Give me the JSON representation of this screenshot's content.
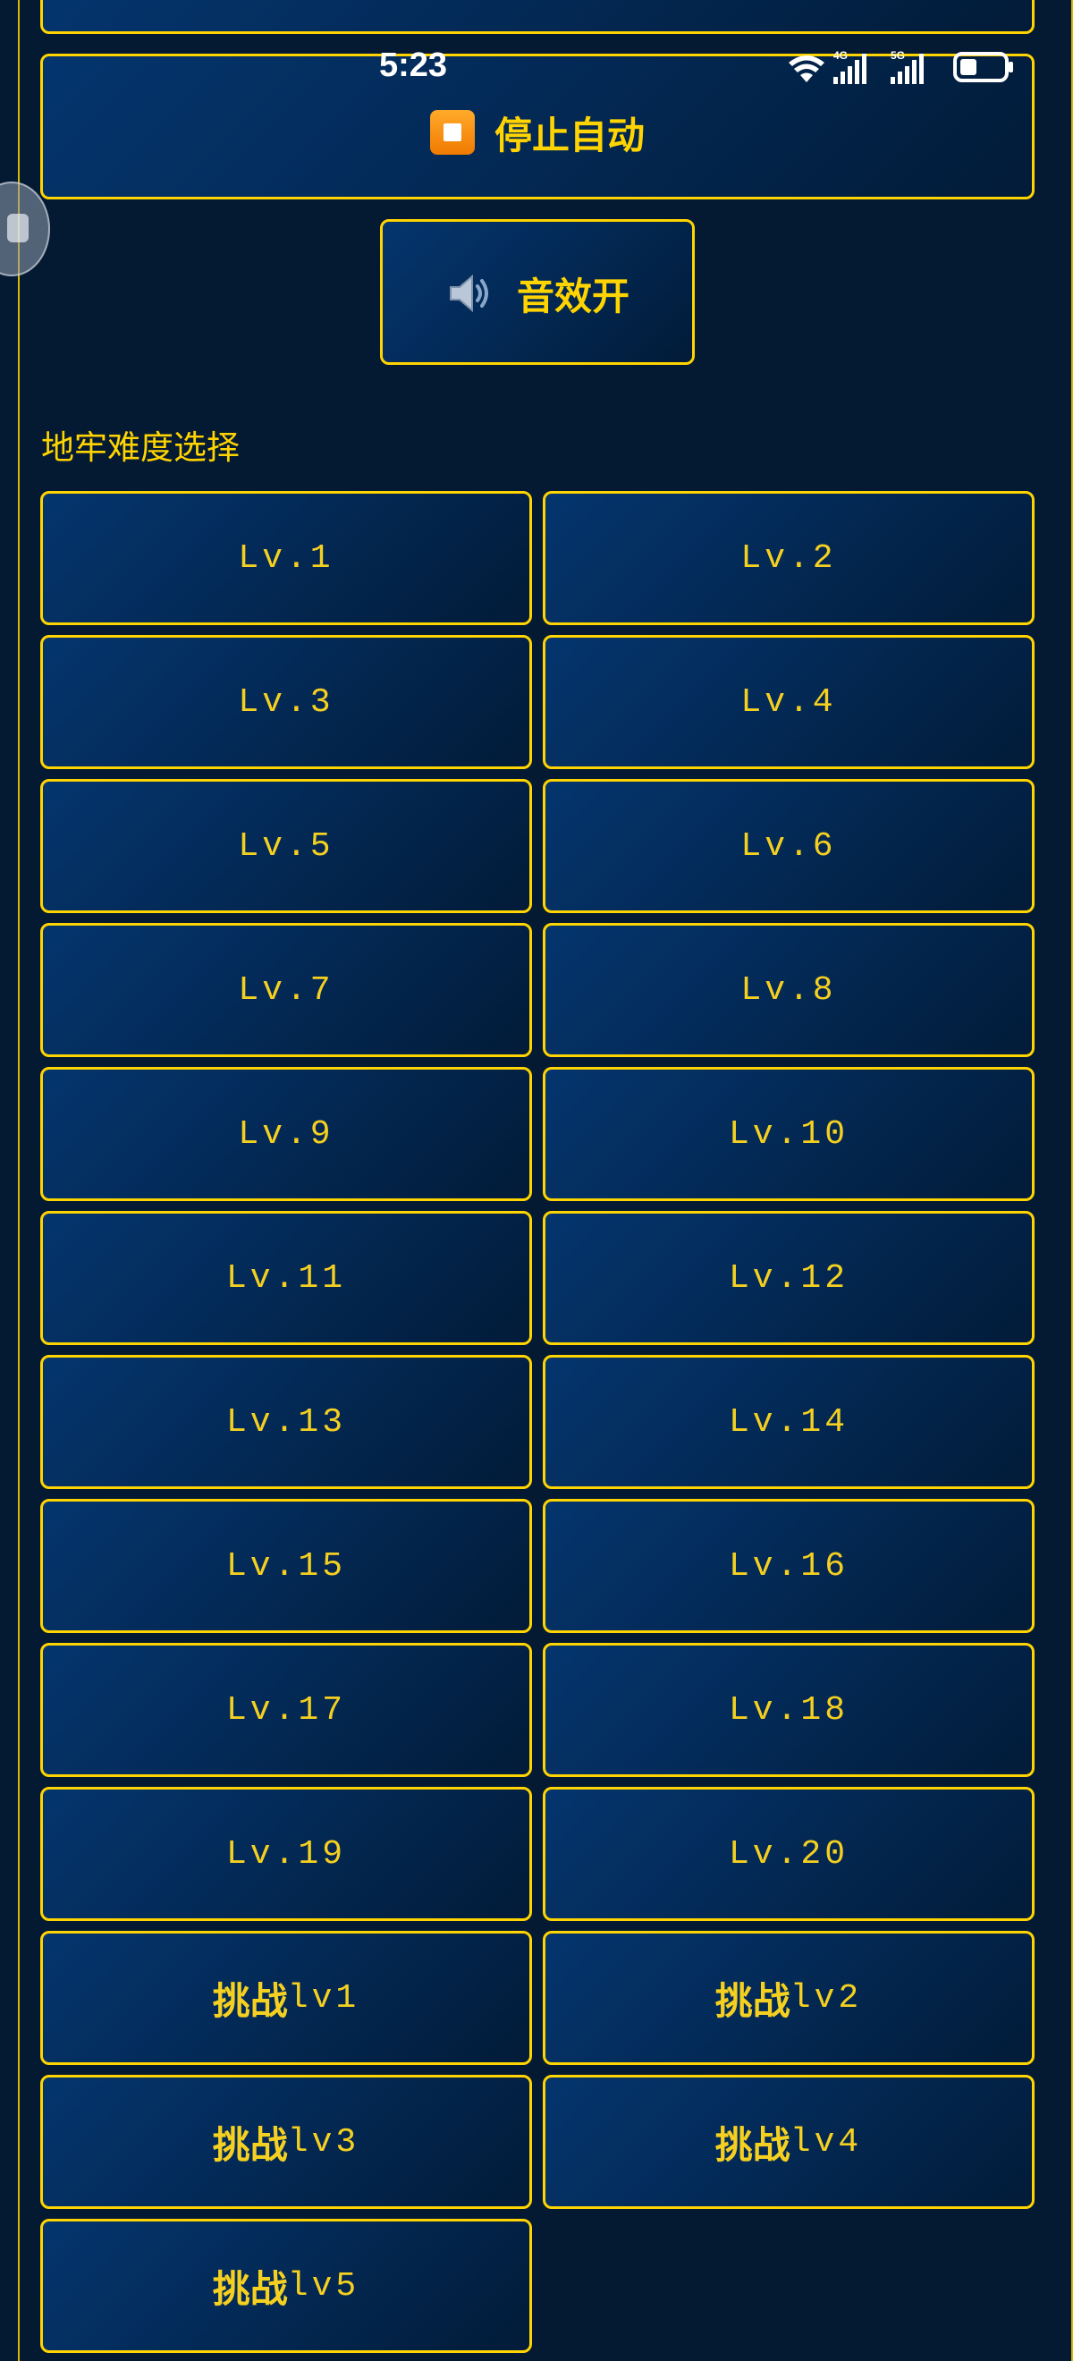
{
  "status_bar": {
    "time": "5:23",
    "network_labels": [
      "4G",
      "5G"
    ]
  },
  "controls": {
    "stop_auto_label": "停止自动",
    "sound_label": "音效开"
  },
  "section": {
    "title": "地牢难度选择"
  },
  "levels": [
    "Lv.1",
    "Lv.2",
    "Lv.3",
    "Lv.4",
    "Lv.5",
    "Lv.6",
    "Lv.7",
    "Lv.8",
    "Lv.9",
    "Lv.10",
    "Lv.11",
    "Lv.12",
    "Lv.13",
    "Lv.14",
    "Lv.15",
    "Lv.16",
    "Lv.17",
    "Lv.18",
    "Lv.19",
    "Lv.20"
  ],
  "challenges": [
    {
      "prefix": "挑战",
      "suffix": "lv1"
    },
    {
      "prefix": "挑战",
      "suffix": "lv2"
    },
    {
      "prefix": "挑战",
      "suffix": "lv3"
    },
    {
      "prefix": "挑战",
      "suffix": "lv4"
    },
    {
      "prefix": "挑战",
      "suffix": "lv5"
    }
  ],
  "icons": {
    "stop": "stop-square-icon",
    "sound": "speaker-icon",
    "wifi": "wifi-icon",
    "signal": "signal-icon",
    "battery": "battery-icon",
    "floating": "floating-handle-icon"
  },
  "colors": {
    "accent": "#ffd400",
    "background": "#041a33",
    "button_top": "#04356e",
    "button_bottom": "#021b38",
    "stop_icon": "#f08a00"
  }
}
